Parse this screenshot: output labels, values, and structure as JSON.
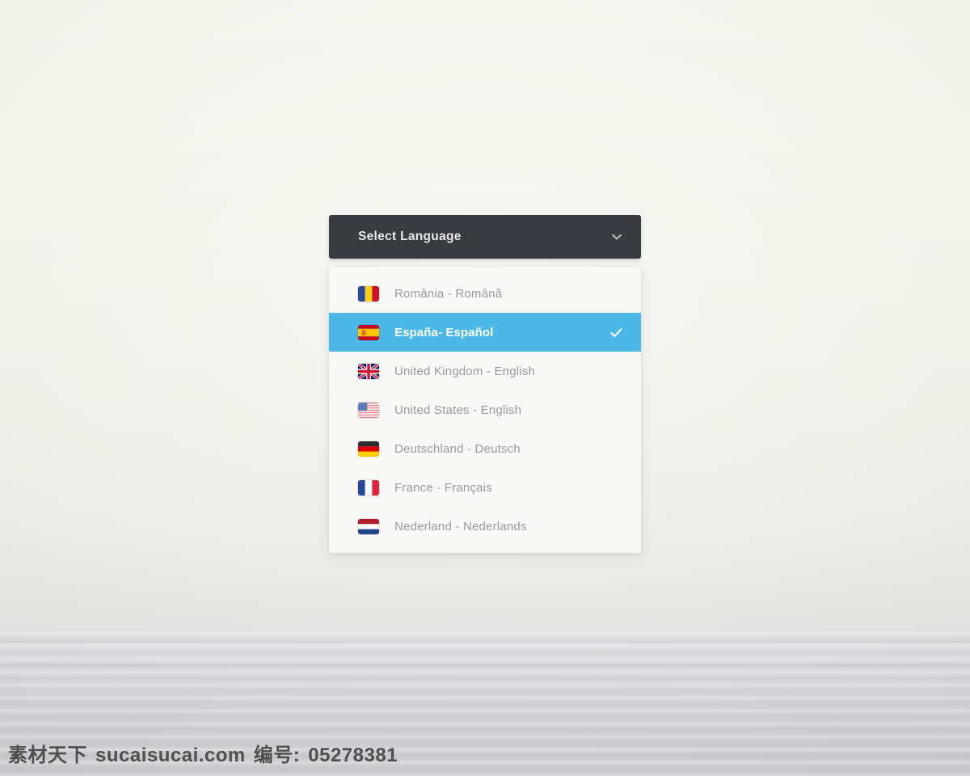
{
  "background": {
    "top_color": "#f3f3ed",
    "bottom_color": "#cdcdd2",
    "description": "studio-backdrop-gradient"
  },
  "dropdown": {
    "header": {
      "label": "Select Language",
      "background_color": "#383b40",
      "text_color": "#e8e8e8",
      "icon": "chevron-down-icon",
      "expanded": true
    },
    "panel": {
      "background_color": "#f8f8f6",
      "highlight_color": "#4cb8e8",
      "item_text_color": "#9a9a9a",
      "selected_text_color": "#ffffff",
      "selected_index": 1,
      "selected_icon": "check-icon"
    },
    "items": [
      {
        "label": "România - Română",
        "flag": "flag-romania",
        "selected": false
      },
      {
        "label": "España- Español",
        "flag": "flag-spain",
        "selected": true
      },
      {
        "label": "United Kingdom - English",
        "flag": "flag-united-kingdom",
        "selected": false
      },
      {
        "label": "United States - English",
        "flag": "flag-united-states",
        "selected": false
      },
      {
        "label": "Deutschland - Deutsch",
        "flag": "flag-germany",
        "selected": false
      },
      {
        "label": "France - Français",
        "flag": "flag-france",
        "selected": false
      },
      {
        "label": "Nederland - Nederlands",
        "flag": "flag-netherlands",
        "selected": false
      }
    ]
  },
  "watermark": {
    "site_cn": "素材天下",
    "site_url": "sucaisucai.com",
    "id_label": "编号:",
    "id_number": "05278381"
  }
}
